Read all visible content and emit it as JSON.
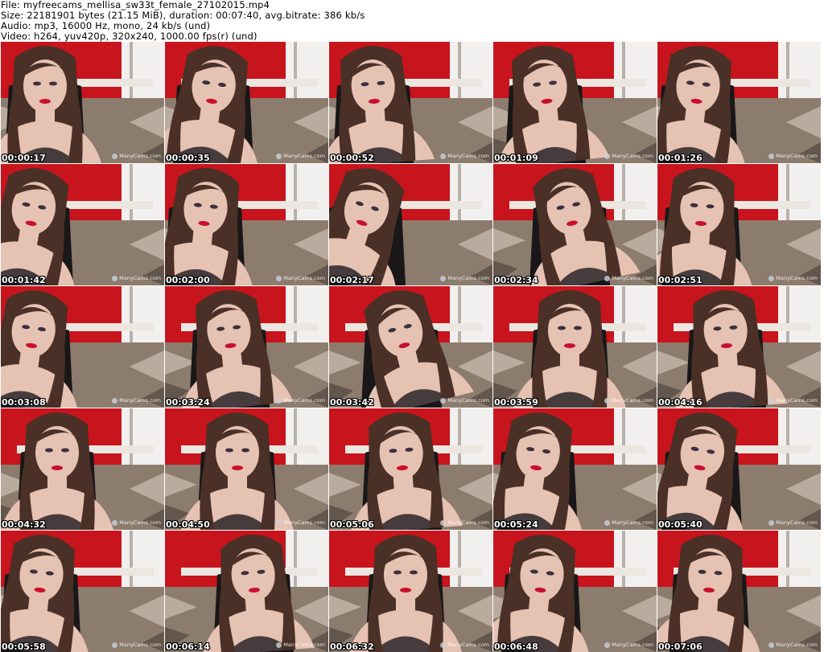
{
  "header": {
    "file_line": "File: myfreecams_mellisa_sw33t_female_27102015.mp4",
    "size_line": "Size: 22181901 bytes (21.15 MiB), duration: 00:07:40, avg.bitrate: 386 kb/s",
    "audio_line": "Audio: mp3, 16000 Hz, mono, 24 kb/s (und)",
    "video_line": "Video: h264, yuv420p, 320x240, 1000.00 fps(r) (und)"
  },
  "watermark": "ManyCams.com",
  "colors": {
    "wall_red": "#c8141c",
    "curtain_white": "#f2f0ee",
    "chair_black": "#1a1718",
    "hair": "#4a3026",
    "skin": "#e6c2b2",
    "lips": "#c8102e",
    "bedspread": "#8c7c6e"
  },
  "thumbnails": [
    {
      "timestamp": "00:00:17"
    },
    {
      "timestamp": "00:00:35"
    },
    {
      "timestamp": "00:00:52"
    },
    {
      "timestamp": "00:01:09"
    },
    {
      "timestamp": "00:01:26"
    },
    {
      "timestamp": "00:01:42"
    },
    {
      "timestamp": "00:02:00"
    },
    {
      "timestamp": "00:02:17"
    },
    {
      "timestamp": "00:02:34"
    },
    {
      "timestamp": "00:02:51"
    },
    {
      "timestamp": "00:03:08"
    },
    {
      "timestamp": "00:03:24"
    },
    {
      "timestamp": "00:03:42"
    },
    {
      "timestamp": "00:03:59"
    },
    {
      "timestamp": "00:04:16"
    },
    {
      "timestamp": "00:04:32"
    },
    {
      "timestamp": "00:04:50"
    },
    {
      "timestamp": "00:05:06"
    },
    {
      "timestamp": "00:05:24"
    },
    {
      "timestamp": "00:05:40"
    },
    {
      "timestamp": "00:05:58"
    },
    {
      "timestamp": "00:06:14"
    },
    {
      "timestamp": "00:06:32"
    },
    {
      "timestamp": "00:06:48"
    },
    {
      "timestamp": "00:07:06"
    }
  ]
}
